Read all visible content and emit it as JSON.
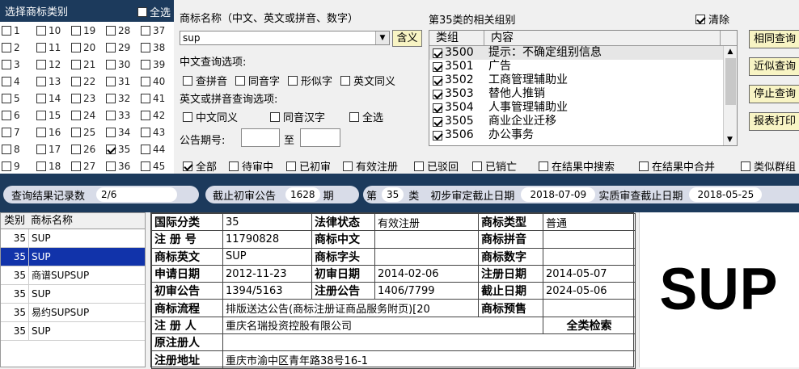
{
  "category_panel": {
    "title": "选择商标类别",
    "select_all": "全选",
    "columns": [
      [
        "1",
        "2",
        "3",
        "4",
        "5",
        "6",
        "7",
        "8",
        "9"
      ],
      [
        "10",
        "11",
        "12",
        "13",
        "14",
        "15",
        "16",
        "17",
        "18"
      ],
      [
        "19",
        "20",
        "21",
        "22",
        "23",
        "24",
        "25",
        "26",
        "27"
      ],
      [
        "28",
        "29",
        "30",
        "31",
        "32",
        "33",
        "34",
        "35",
        "36"
      ],
      [
        "37",
        "38",
        "39",
        "40",
        "41",
        "42",
        "43",
        "44",
        "45"
      ]
    ],
    "checked": "35"
  },
  "query": {
    "name_label": "商标名称（中文、英文或拼音、数字）",
    "name_value": "sup",
    "meaning_button": "含义",
    "cn_options_label": "中文查询选项:",
    "cn_options": [
      "查拼音",
      "同音字",
      "形似字",
      "英文同义"
    ],
    "en_options_label": "英文或拼音查询选项:",
    "en_options": [
      "中文同义",
      "同音汉字",
      "全选"
    ],
    "issue_label": "公告期号:",
    "issue_to": "至"
  },
  "groups": {
    "title": "第35类的相关组别",
    "clear": "清除",
    "header_group": "类组",
    "header_content": "内容",
    "rows": [
      {
        "code": "3500",
        "text": "提示：不确定组别信息"
      },
      {
        "code": "3501",
        "text": "广告"
      },
      {
        "code": "3502",
        "text": "工商管理辅助业"
      },
      {
        "code": "3503",
        "text": "替他人推销"
      },
      {
        "code": "3504",
        "text": "人事管理辅助业"
      },
      {
        "code": "3505",
        "text": "商业企业迁移"
      },
      {
        "code": "3506",
        "text": "办公事务"
      }
    ]
  },
  "buttons": {
    "same": "相同查询",
    "similar": "近似查询",
    "stop": "停止查询",
    "print": "报表打印"
  },
  "filters": {
    "all": "全部",
    "pending": "待审中",
    "prelim": "已初审",
    "valid": "有效注册",
    "rejected": "已驳回",
    "cancelled": "已销亡",
    "search_in": "在结果中搜索",
    "merge_in": "在结果中合并",
    "similar_group": "类似群组"
  },
  "status": {
    "count_label": "查询结果记录数",
    "count_value": "2/6",
    "deadline_label": "截止初审公告",
    "deadline_value": "1628",
    "deadline_unit": "期",
    "class_prefix": "第",
    "class_value": "35",
    "class_suffix": "类",
    "prelim_date_label": "初步审定截止日期",
    "prelim_date_value": "2018-07-09",
    "exam_date_label": "实质审查截止日期",
    "exam_date_value": "2018-05-25"
  },
  "results": {
    "header_class": "类别",
    "header_name": "商标名称",
    "rows": [
      {
        "cls": "35",
        "name": "SUP"
      },
      {
        "cls": "35",
        "name": "SUP"
      },
      {
        "cls": "35",
        "name": "商谱SUPSUP"
      },
      {
        "cls": "35",
        "name": "SUP"
      },
      {
        "cls": "35",
        "name": "易约SUPSUP"
      },
      {
        "cls": "35",
        "name": "SUP"
      }
    ],
    "selected_index": 1
  },
  "detail": {
    "intl_class_k": "国际分类",
    "intl_class_v": "35",
    "legal_status_k": "法律状态",
    "legal_status_v": "有效注册",
    "type_k": "商标类型",
    "type_v": "普通",
    "reg_no_k": "注 册 号",
    "reg_no_v": "11790828",
    "cn_k": "商标中文",
    "cn_v": "",
    "pinyin_k": "商标拼音",
    "pinyin_v": "",
    "en_k": "商标英文",
    "en_v": "SUP",
    "head_k": "商标字头",
    "head_v": "",
    "num_k": "商标数字",
    "num_v": "",
    "apply_k": "申请日期",
    "apply_v": "2012-11-23",
    "prelim_k": "初审日期",
    "prelim_v": "2014-02-06",
    "regdate_k": "注册日期",
    "regdate_v": "2014-05-07",
    "prelim_pub_k": "初审公告",
    "prelim_pub_v": "1394/5163",
    "reg_pub_k": "注册公告",
    "reg_pub_v": "1406/7799",
    "expiry_k": "截止日期",
    "expiry_v": "2024-05-06",
    "flow_k": "商标流程",
    "flow_v": "排版送达公告(商标注册证商品服务附页)[20",
    "presale_k": "商标预售",
    "owner_k": "注 册 人",
    "owner_v": "重庆名瑞投资控股有限公司",
    "all_class_search": "全类检索",
    "orig_k": "原注册人",
    "orig_v": "",
    "addr_k": "注册地址",
    "addr_v": "重庆市渝中区青年路38号16-1"
  },
  "preview": {
    "text": "SUP"
  }
}
